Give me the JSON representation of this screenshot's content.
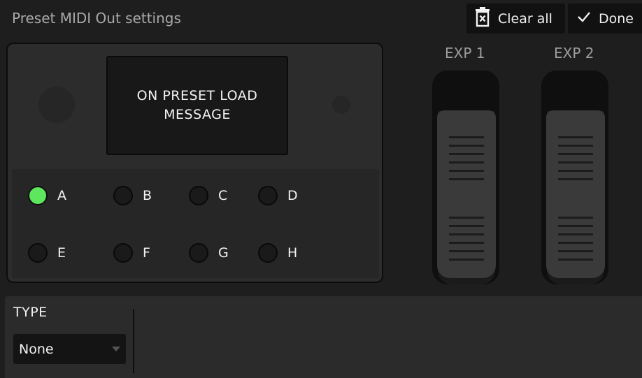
{
  "header": {
    "title": "Preset MIDI Out settings",
    "clear_all_label": "Clear all",
    "clear_icon": "trash-x-icon",
    "done_label": "Done",
    "done_icon": "check-icon"
  },
  "device": {
    "screen_text": "ON PRESET LOAD MESSAGE",
    "switches_row1": [
      {
        "label": "A",
        "active": true
      },
      {
        "label": "B",
        "active": false
      },
      {
        "label": "C",
        "active": false
      },
      {
        "label": "D",
        "active": false
      }
    ],
    "switches_row2": [
      {
        "label": "E",
        "active": false
      },
      {
        "label": "F",
        "active": false
      },
      {
        "label": "G",
        "active": false
      },
      {
        "label": "H",
        "active": false
      }
    ],
    "active_led_color": "#5ee65e"
  },
  "expression": [
    {
      "label": "EXP 1"
    },
    {
      "label": "EXP 2"
    }
  ],
  "panel": {
    "type_label": "TYPE",
    "type_value": "None"
  }
}
